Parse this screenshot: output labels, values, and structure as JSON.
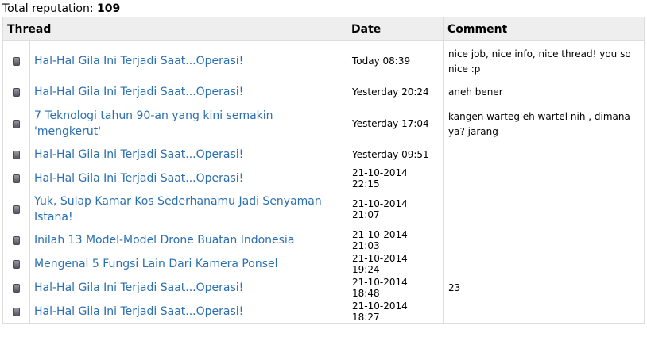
{
  "summary": {
    "label": "Total reputation: ",
    "value": "109"
  },
  "table": {
    "headers": {
      "thread": "Thread",
      "date": "Date",
      "comment": "Comment"
    },
    "rows": [
      {
        "thread": "Hal-Hal Gila Ini Terjadi Saat...Operasi!",
        "date": "Today 08:39",
        "comment": "nice job, nice info, nice thread! you so nice :p"
      },
      {
        "thread": "Hal-Hal Gila Ini Terjadi Saat...Operasi!",
        "date": "Yesterday 20:24",
        "comment": "aneh bener"
      },
      {
        "thread": "7 Teknologi tahun 90-an yang kini semakin 'mengkerut'",
        "date": "Yesterday 17:04",
        "comment": "kangen warteg eh wartel nih , dimana ya? jarang"
      },
      {
        "thread": "Hal-Hal Gila Ini Terjadi Saat...Operasi!",
        "date": "Yesterday 09:51",
        "comment": ""
      },
      {
        "thread": "Hal-Hal Gila Ini Terjadi Saat...Operasi!",
        "date": "21-10-2014 22:15",
        "comment": ""
      },
      {
        "thread": "Yuk, Sulap Kamar Kos Sederhanamu Jadi Senyaman Istana!",
        "date": "21-10-2014 21:07",
        "comment": ""
      },
      {
        "thread": "Inilah 13 Model-Model Drone Buatan Indonesia",
        "date": "21-10-2014 21:03",
        "comment": ""
      },
      {
        "thread": "Mengenal 5 Fungsi Lain Dari Kamera Ponsel",
        "date": "21-10-2014 19:24",
        "comment": ""
      },
      {
        "thread": "Hal-Hal Gila Ini Terjadi Saat...Operasi!",
        "date": "21-10-2014 18:48",
        "comment": "23"
      },
      {
        "thread": "Hal-Hal Gila Ini Terjadi Saat...Operasi!",
        "date": "21-10-2014 18:27",
        "comment": ""
      }
    ]
  },
  "colors": {
    "link": "#2a6fb0",
    "header_bg": "#eeeeee",
    "border": "#dddddd"
  },
  "icons": {
    "row_bullet": "post-bullet-icon"
  }
}
